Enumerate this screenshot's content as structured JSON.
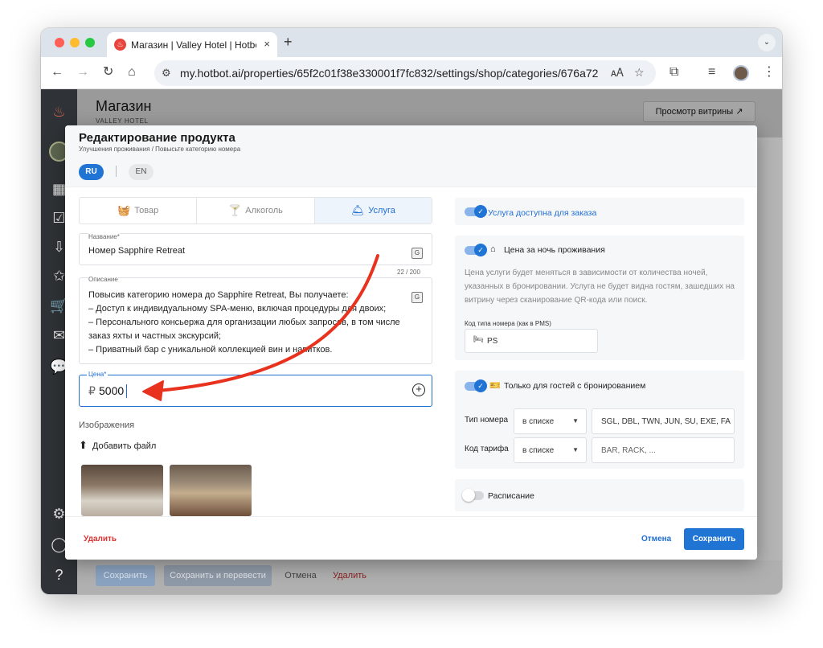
{
  "browser": {
    "tab_title": "Магазин | Valley Hotel | Hotbot",
    "new_tab": "+",
    "tab_close": "×",
    "url": "my.hotbot.ai/properties/65f2c01f38e330001f7fc832/settings/shop/categories/676a72..."
  },
  "page": {
    "title": "Магазин",
    "subtitle": "VALLEY HOTEL",
    "preview_button": "Просмотр витрины ↗"
  },
  "bottom_bar": {
    "save": "Сохранить",
    "save_translate": "Сохранить и перевести",
    "cancel": "Отмена",
    "delete": "Удалить"
  },
  "modal": {
    "title": "Редактирование продукта",
    "breadcrumb": "Улучшения проживания / Повысьте категорию номера",
    "languages": [
      "RU",
      "EN"
    ],
    "tabs": [
      {
        "label": "Товар",
        "icon": "basket-icon"
      },
      {
        "label": "Алкоголь",
        "icon": "cocktail-icon"
      },
      {
        "label": "Услуга",
        "icon": "service-icon",
        "active": true
      }
    ],
    "name_field": {
      "label": "Название*",
      "value": "Номер Sapphire Retreat"
    },
    "description_field": {
      "label": "Описание",
      "counter": "22 / 200",
      "value": "Повысив категорию номера до Sapphire Retreat, Вы получаете:\n– Доступ к индивидуальному SPA-меню, включая процедуры для двоих;\n– Персонального консьержа для организации любых запросов, в том числе заказ яхты и частных экскурсий;\n– Приватный бар с уникальной коллекцией вин и напитков."
    },
    "price_field": {
      "label": "Цена*",
      "currency": "₽",
      "value": "5000"
    },
    "images": {
      "heading": "Изображения",
      "upload": "Добавить файл"
    },
    "right": {
      "available_toggle": {
        "label": "Услуга доступна для заказа",
        "on": true
      },
      "per_night": {
        "label": "Цена за ночь проживания",
        "on": true,
        "description": "Цена услуги будет меняться в зависимости от количества ночей, указанных в бронировании. Услуга не будет видна гостям, зашедших на витрину через сканирование QR-кода или поиск.",
        "room_code_label": "Код типа номера (как в PMS)",
        "room_code_value": "PS"
      },
      "guests_only": {
        "label": "Только для гостей с бронированием",
        "on": true,
        "room_type_label": "Тип номера",
        "room_type_select": "в списке",
        "room_type_value": "SGL, DBL, TWN, JUN, SU, EXE, FA",
        "rate_code_label": "Код тарифа",
        "rate_code_select": "в списке",
        "rate_code_placeholder": "BAR, RACK, ..."
      },
      "schedule": {
        "label": "Расписание",
        "on": false
      }
    },
    "footer": {
      "delete": "Удалить",
      "cancel": "Отмена",
      "save": "Сохранить"
    }
  },
  "colors": {
    "accent": "#1f74d4",
    "danger": "#d33333",
    "annotation_arrow": "#e8321e"
  }
}
